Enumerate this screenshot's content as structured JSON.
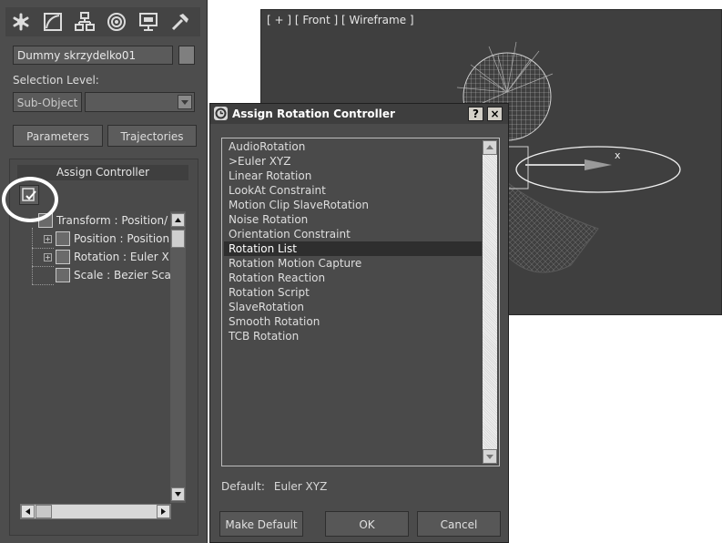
{
  "command_panel": {
    "tabs": [
      {
        "name": "create-tab",
        "icon": "asterisk-icon"
      },
      {
        "name": "modify-tab",
        "icon": "curve-icon"
      },
      {
        "name": "hierarchy-tab",
        "icon": "hierarchy-icon"
      },
      {
        "name": "motion-tab",
        "icon": "motion-icon"
      },
      {
        "name": "display-tab",
        "icon": "display-icon"
      },
      {
        "name": "utilities-tab",
        "icon": "hammer-icon"
      }
    ],
    "object_name": "Dummy skrzydelko01",
    "selection_level_label": "Selection Level:",
    "sub_object_label": "Sub-Object",
    "parameters_label": "Parameters",
    "trajectories_label": "Trajectories",
    "rollout_title": "Assign Controller",
    "tree": [
      {
        "label": "Transform : Position/",
        "icon": "transform-icon"
      },
      {
        "label": "Position : Position",
        "icon": "position-icon"
      },
      {
        "label": "Rotation : Euler X",
        "icon": "rotation-icon"
      },
      {
        "label": "Scale : Bezier Sca",
        "icon": "scale-icon"
      }
    ]
  },
  "viewport": {
    "label": "[ + ] [ Front ] [ Wireframe ]",
    "gizmo_axis_label": "x"
  },
  "dialog": {
    "title": "Assign Rotation Controller",
    "help_label": "?",
    "close_label": "×",
    "items": [
      "AudioRotation",
      ">Euler XYZ",
      "Linear Rotation",
      "LookAt Constraint",
      "Motion Clip SlaveRotation",
      "Noise Rotation",
      "Orientation Constraint",
      "Rotation List",
      "Rotation Motion Capture",
      "Rotation Reaction",
      "Rotation Script",
      "SlaveRotation",
      "Smooth Rotation",
      "TCB Rotation"
    ],
    "selected_index": 7,
    "default_label": "Default:",
    "default_value": "Euler XYZ",
    "make_default_label": "Make Default",
    "ok_label": "OK",
    "cancel_label": "Cancel"
  }
}
